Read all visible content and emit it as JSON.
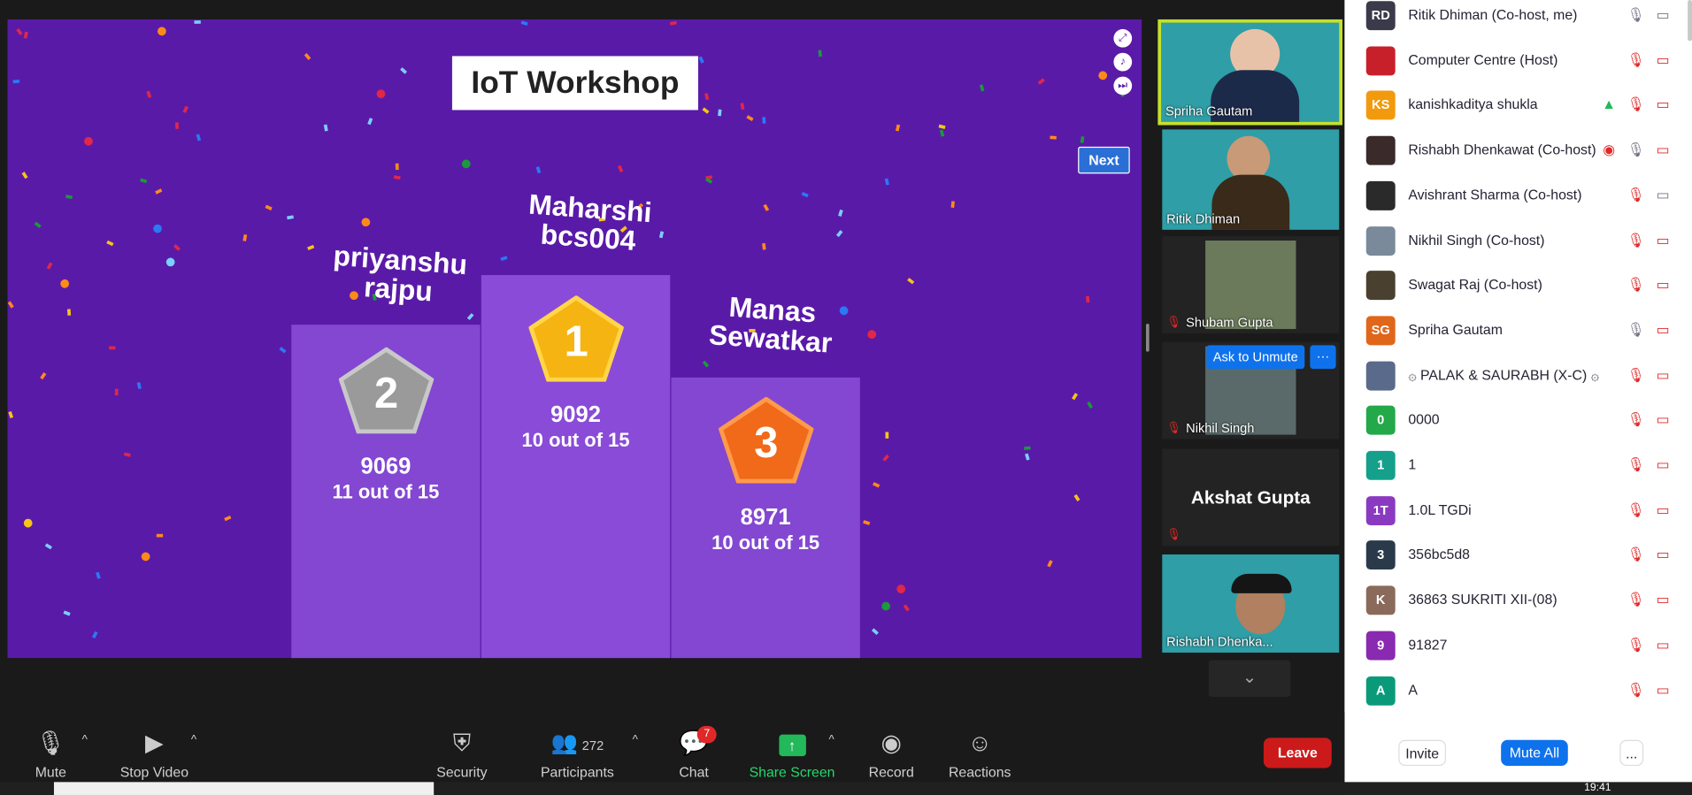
{
  "share": {
    "title": "IoT Workshop",
    "next_label": "Next"
  },
  "podium": [
    {
      "rank": "2",
      "name_line1": "priyanshu",
      "name_line2": "rajpu",
      "score": "9069",
      "correct": "11 out of 15"
    },
    {
      "rank": "1",
      "name_line1": "Maharshi",
      "name_line2": "bcs004",
      "score": "9092",
      "correct": "10 out of 15"
    },
    {
      "rank": "3",
      "name_line1": "Manas",
      "name_line2": "Sewatkar",
      "score": "8971",
      "correct": "10 out of 15"
    }
  ],
  "videos": [
    {
      "name": "Spriha Gautam"
    },
    {
      "name": "Ritik Dhiman"
    },
    {
      "name": "Shubam Gupta"
    },
    {
      "name": "Nikhil Singh",
      "ask_label": "Ask to Unmute",
      "more_label": "···"
    },
    {
      "name": "Akshat Gupta"
    },
    {
      "name": "Rishabh Dhenka..."
    }
  ],
  "participants": [
    {
      "initials": "RD",
      "name": "Ritik Dhiman (Co-host, me)",
      "color": "#3a3a4a"
    },
    {
      "initials": "",
      "name": "Computer Centre (Host)",
      "color": "#c8202a"
    },
    {
      "initials": "KS",
      "name": "kanishkaditya shukla",
      "color": "#f29a0e"
    },
    {
      "initials": "",
      "name": "Rishabh Dhenkawat (Co-host)",
      "color": "#3a2a2a"
    },
    {
      "initials": "",
      "name": "Avishrant Sharma (Co-host)",
      "color": "#2a2a2a"
    },
    {
      "initials": "",
      "name": "Nikhil Singh (Co-host)",
      "color": "#7a8a9a"
    },
    {
      "initials": "",
      "name": "Swagat Raj (Co-host)",
      "color": "#4a4030"
    },
    {
      "initials": "SG",
      "name": "Spriha Gautam",
      "color": "#e0661a"
    },
    {
      "initials": "",
      "name": "۞ PALAK & SAURABH (X-C) ۞",
      "color": "#5a6a8a"
    },
    {
      "initials": "0",
      "name": "0000",
      "color": "#23a84a"
    },
    {
      "initials": "1",
      "name": "1",
      "color": "#14a08a"
    },
    {
      "initials": "1T",
      "name": "1.0L TGDi",
      "color": "#8a3ac0"
    },
    {
      "initials": "3",
      "name": "356bc5d8",
      "color": "#2a3a4a"
    },
    {
      "initials": "K",
      "name": "36863 SUKRITI XII-(08)",
      "color": "#8a6a5a"
    },
    {
      "initials": "9",
      "name": "91827",
      "color": "#8a2ab0"
    },
    {
      "initials": "A",
      "name": "A",
      "color": "#0a9a7a"
    }
  ],
  "panel_buttons": {
    "invite": "Invite",
    "mute_all": "Mute All",
    "more": "..."
  },
  "toolbar": {
    "mute": "Mute",
    "stop_video": "Stop Video",
    "security": "Security",
    "participants": "Participants",
    "participants_count": "272",
    "chat": "Chat",
    "chat_badge": "7",
    "share_screen": "Share Screen",
    "record": "Record",
    "reactions": "Reactions",
    "leave": "Leave"
  },
  "clock": "19:41"
}
